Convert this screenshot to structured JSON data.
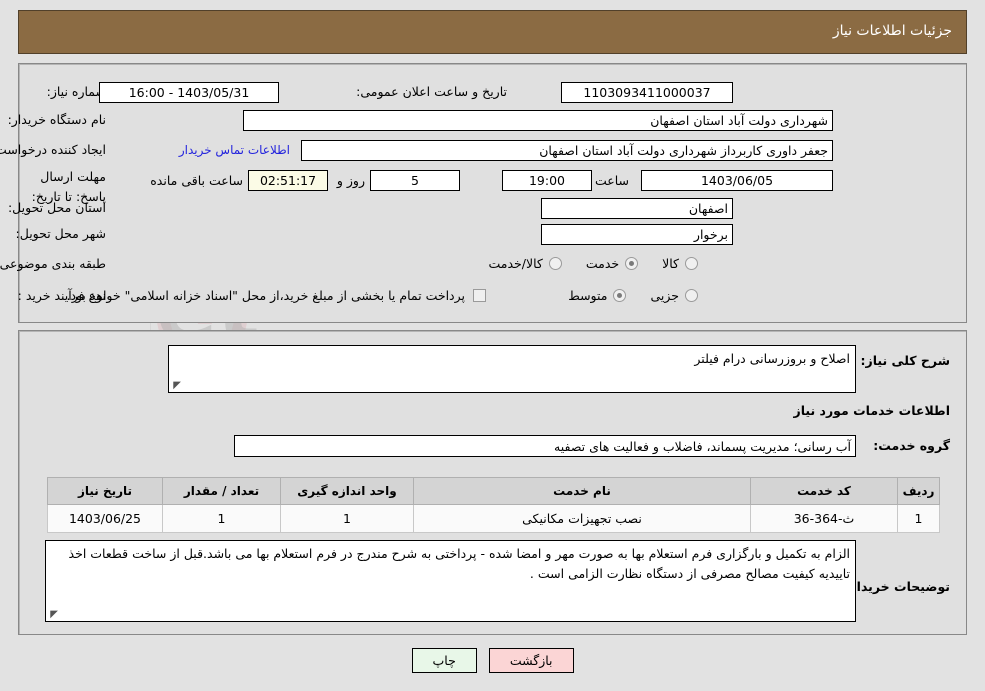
{
  "header": {
    "title": "جزئیات اطلاعات نیاز"
  },
  "top_form": {
    "need_no_label": "شماره نیاز:",
    "need_no_value": "1103093411000037",
    "announce_label": "تاریخ و ساعت اعلان عمومی:",
    "announce_value": "1403/05/31 - 16:00",
    "buyer_org_label": "نام دستگاه خریدار:",
    "buyer_org_value": "شهرداری دولت آباد استان اصفهان",
    "creator_label": "ایجاد کننده درخواست:",
    "creator_value": "جعفر داوری کاربرداز شهرداری دولت آباد استان اصفهان",
    "contact_link": "اطلاعات تماس خریدار",
    "deadline_label": "مهلت ارسال پاسخ: تا تاریخ:",
    "deadline_date": "1403/06/05",
    "hour_label": "ساعت",
    "hour_value": "19:00",
    "days_value": "5",
    "days_label": "روز و",
    "countdown_value": "02:51:17",
    "countdown_label": "ساعت باقی مانده",
    "province_label": "استان محل تحویل:",
    "province_value": "اصفهان",
    "city_label": "شهر محل تحویل:",
    "city_value": "برخوار",
    "category_label": "طبقه بندی موضوعی:",
    "category_options": [
      {
        "label": "کالا",
        "selected": false
      },
      {
        "label": "خدمت",
        "selected": true
      },
      {
        "label": "کالا/خدمت",
        "selected": false
      }
    ],
    "process_label": "نوع فرآیند خرید :",
    "process_options": [
      {
        "label": "جزیی",
        "selected": false
      },
      {
        "label": "متوسط",
        "selected": true
      }
    ],
    "treasury_checkbox_checked": false,
    "treasury_text": "پرداخت تمام یا بخشی از مبلغ خرید،از محل \"اسناد خزانه اسلامی\" خواهد بود."
  },
  "mid_form": {
    "general_desc_label": "شرح کلی نیاز:",
    "general_desc_value": "اصلاح و بروزرسانی درام فیلتر",
    "services_heading": "اطلاعات خدمات مورد نیاز",
    "service_group_label": "گروه خدمت:",
    "service_group_value": "آب رسانی؛ مدیریت پسماند، فاضلاب و فعالیت های تصفیه",
    "table": {
      "columns": [
        "ردیف",
        "کد خدمت",
        "نام خدمت",
        "واحد اندازه گیری",
        "تعداد / مقدار",
        "تاریخ نیاز"
      ],
      "rows": [
        {
          "row_no": "1",
          "service_code": "ث-364-36",
          "service_name": "نصب تجهیزات مکانیکی",
          "unit": "1",
          "quantity": "1",
          "need_date": "1403/06/25"
        }
      ]
    },
    "buyer_notes_label": "توضیحات خریدار:",
    "buyer_notes_value": "الزام به تکمیل و بارگزاری فرم استعلام بها به صورت مهر و امضا شده - پرداختی به شرح مندرج در فرم استعلام بها می باشد.قبل از ساخت قطعات اخذ تاییدیه کیفیت مصالح مصرفی از دستگاه نظارت الزامی است ."
  },
  "footer": {
    "print_label": "چاپ",
    "back_label": "بازگشت"
  },
  "watermark": {
    "text": "AriaTender.net"
  },
  "colors": {
    "header_bg": "#8b6b43",
    "page_bg": "#e2e2e2",
    "panel_bg": "#e0e0e0",
    "link": "#2323dd",
    "print_btn": "#e8f7e8",
    "back_btn": "#fbd5d5"
  }
}
